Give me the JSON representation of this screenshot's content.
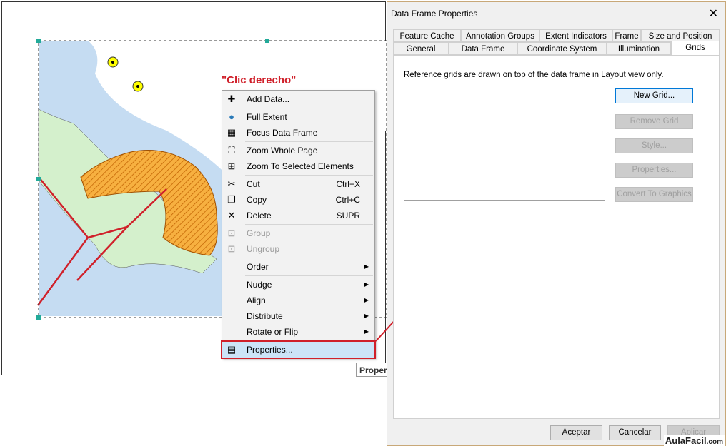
{
  "caption": "\"Clic derecho\"",
  "context_menu": {
    "items": [
      {
        "label": "Add Data...",
        "icon": "add-data-icon"
      },
      {
        "label": "Full Extent",
        "icon": "globe-icon"
      },
      {
        "label": "Focus Data Frame",
        "icon": "focus-data-frame-icon"
      },
      {
        "label": "Zoom Whole Page",
        "icon": "zoom-whole-page-icon"
      },
      {
        "label": "Zoom To Selected Elements",
        "icon": "zoom-selected-icon"
      },
      {
        "label": "Cut",
        "shortcut": "Ctrl+X",
        "icon": "scissors-icon"
      },
      {
        "label": "Copy",
        "shortcut": "Ctrl+C",
        "icon": "copy-icon"
      },
      {
        "label": "Delete",
        "shortcut": "SUPR",
        "icon": "delete-x-icon"
      },
      {
        "label": "Group",
        "icon": "group-icon",
        "disabled": true
      },
      {
        "label": "Ungroup",
        "icon": "ungroup-icon",
        "disabled": true
      },
      {
        "label": "Order",
        "submenu": true
      },
      {
        "label": "Nudge",
        "submenu": true
      },
      {
        "label": "Align",
        "submenu": true
      },
      {
        "label": "Distribute",
        "submenu": true
      },
      {
        "label": "Rotate or Flip",
        "submenu": true
      },
      {
        "label": "Properties...",
        "icon": "properties-icon",
        "highlighted": true
      }
    ]
  },
  "tooltip": "Proper",
  "dialog": {
    "title": "Data Frame Properties",
    "tabs_row1": [
      "Feature Cache",
      "Annotation Groups",
      "Extent Indicators",
      "Frame",
      "Size and Position"
    ],
    "tabs_row2": [
      "General",
      "Data Frame",
      "Coordinate System",
      "Illumination",
      "Grids"
    ],
    "active_tab": "Grids",
    "description": "Reference grids are drawn on top of the data frame in Layout view only.",
    "buttons": {
      "new_grid": "New Grid...",
      "remove_grid": "Remove Grid",
      "style": "Style...",
      "properties": "Properties...",
      "convert": "Convert To Graphics"
    },
    "footer": {
      "ok": "Aceptar",
      "cancel": "Cancelar",
      "apply": "Aplicar"
    }
  },
  "watermark": "AulaFacil",
  "watermark_suffix": ".com",
  "colors": {
    "highlight": "#d0202a",
    "water": "#c5dcf2",
    "town": "#d4f0cc",
    "hatch": "#f5a020"
  }
}
